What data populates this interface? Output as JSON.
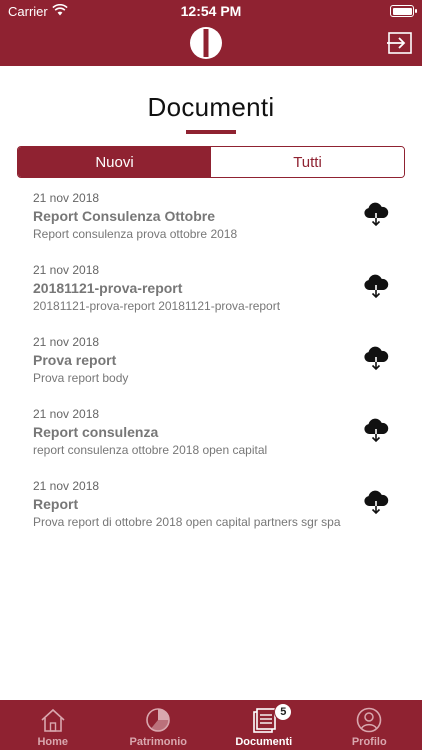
{
  "status_bar": {
    "carrier": "Carrier",
    "time": "12:54 PM"
  },
  "header": {
    "logo_icon": "logo-icon",
    "logout_icon": "logout-icon"
  },
  "page": {
    "title": "Documenti"
  },
  "segments": {
    "new_label": "Nuovi",
    "all_label": "Tutti",
    "selected": "Nuovi"
  },
  "documents": [
    {
      "date": "21 nov 2018",
      "title": "Report Consulenza Ottobre",
      "description": "Report consulenza prova ottobre 2018"
    },
    {
      "date": "21 nov 2018",
      "title": "20181121-prova-report",
      "description": "20181121-prova-report 20181121-prova-report"
    },
    {
      "date": "21 nov 2018",
      "title": "Prova report",
      "description": "Prova report body"
    },
    {
      "date": "21 nov 2018",
      "title": "Report consulenza",
      "description": "report consulenza ottobre 2018 open capital"
    },
    {
      "date": "21 nov 2018",
      "title": "Report",
      "description": "Prova report di ottobre 2018 open capital partners sgr spa"
    }
  ],
  "tabbar": {
    "home": "Home",
    "patrimonio": "Patrimonio",
    "documenti": "Documenti",
    "documenti_badge": "5",
    "profilo": "Profilo",
    "active": "Documenti"
  },
  "colors": {
    "brand": "#8f2231",
    "tab_inactive": "#d9a7ae"
  }
}
